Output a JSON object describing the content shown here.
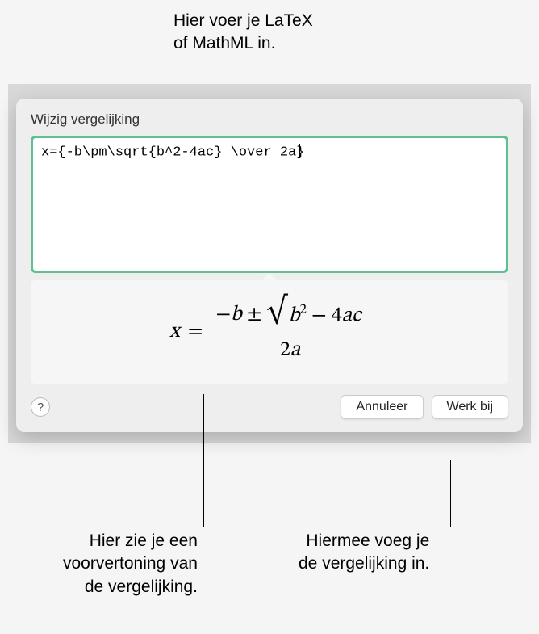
{
  "callouts": {
    "top": "Hier voer je LaTeX\nof MathML in.",
    "preview": "Hier zie je een\nvoorvertoning van\nde vergelijking.",
    "update": "Hiermee voeg je\nde vergelijking in."
  },
  "dialog": {
    "title": "Wijzig vergelijking",
    "input_value": "x={-b\\pm\\sqrt{b^2-4ac} \\over 2a}",
    "help_label": "?",
    "cancel_label": "Annuleer",
    "update_label": "Werk bij"
  },
  "preview": {
    "lhs": "x",
    "eq": "=",
    "neg": "−",
    "b": "b",
    "pm": "±",
    "b2": "b",
    "sup2": "2",
    "minus": " − 4",
    "a": "a",
    "c": "c",
    "den_two": "2",
    "den_a": "a"
  }
}
